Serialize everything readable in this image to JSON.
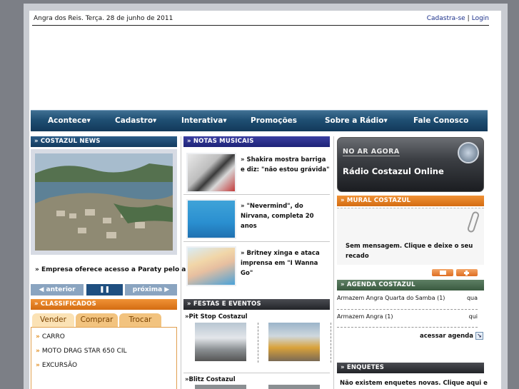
{
  "topbar": {
    "date": "Angra dos Reis. Terça. 28 de junho de 2011",
    "signup": "Cadastra-se",
    "separator": "|",
    "login": "Login"
  },
  "nav": [
    {
      "label": "Acontece▾"
    },
    {
      "label": "Cadastro▾"
    },
    {
      "label": "Interativa▾"
    },
    {
      "label": "Promoções"
    },
    {
      "label": "Sobre a Rádio▾"
    },
    {
      "label": "Fale Conosco"
    }
  ],
  "news": {
    "header": "» COSTAZUL NEWS",
    "caption": "» Empresa oferece acesso a Paraty pelo ar",
    "prev": "◀ anterior",
    "pause": "❚❚",
    "next": "próxima ▶"
  },
  "classificados": {
    "header": "» CLASSIFICADOS",
    "tabs": [
      "Vender",
      "Comprar",
      "Trocar"
    ],
    "items": [
      "CARRO",
      "MOTO DRAG STAR 650 CIL",
      "EXCURSÃO"
    ]
  },
  "notas": {
    "header": "» NOTAS MUSICAIS",
    "items": [
      {
        "text": "» Shakira mostra barriga e diz: \"não estou grávida\""
      },
      {
        "text": "» \"Nevermind\", do Nirvana, completa 20 anos"
      },
      {
        "text": "» Britney xinga e ataca imprensa em \"I Wanna Go\""
      }
    ]
  },
  "festas": {
    "header": "» FESTAS E EVENTOS",
    "events": [
      "»Pit Stop Costazul",
      "»Blitz Costazul"
    ]
  },
  "radio": {
    "onair": "NO AR AGORA",
    "station": "Rádio Costazul Online"
  },
  "mural": {
    "header": "» MURAL COSTAZUL",
    "message": "Sem mensagem. Clique e deixe o seu recado"
  },
  "agenda": {
    "header": "» AGENDA COSTAZUL",
    "rows": [
      {
        "name": "Armazem Angra Quarta do Samba (1)",
        "day": "qua"
      },
      {
        "name": "Armazem Angra (1)",
        "day": "qui"
      }
    ],
    "link": "acessar agenda",
    "link_icon": "↘"
  },
  "enquetes": {
    "header": "» ENQUETES",
    "text": "Não existem enquetes novas. Clique aqui e"
  },
  "colors": {
    "nav_blue": "#1f4f73",
    "header_blue": "#133a5e",
    "header_orange": "#d46c12",
    "header_green": "#3a5a40"
  }
}
